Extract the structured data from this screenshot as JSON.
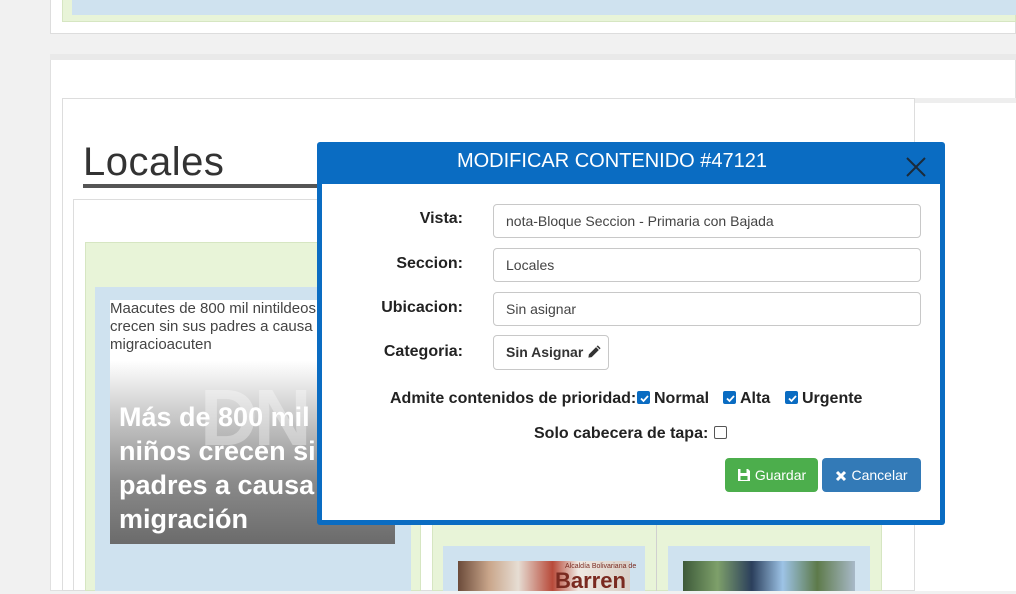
{
  "page": {
    "section_title": "Locales",
    "broken_image_alt": "Maacutes de 800 mil nintildeos crecen sin sus padres a causa de la migracioacuten",
    "watermark": "DN",
    "news_headline": "Más de 800 mil niños crecen sin sus padres a causa de la migración",
    "thumb1_caption_small": "Alcaldía Bolivariana de",
    "thumb1_caption": "Barren"
  },
  "modal": {
    "title": "MODIFICAR CONTENIDO #47121",
    "vista_label": "Vista:",
    "vista_value": "nota-Bloque Seccion - Primaria con Bajada",
    "seccion_label": "Seccion:",
    "seccion_value": "Locales",
    "ubicacion_label": "Ubicacion:",
    "ubicacion_value": "Sin asignar",
    "categoria_label": "Categoria:",
    "categoria_button": "Sin Asignar",
    "prioridad_label": "Admite contenidos de prioridad:",
    "prioridades": [
      {
        "label": "Normal",
        "checked": true
      },
      {
        "label": "Alta",
        "checked": true
      },
      {
        "label": "Urgente",
        "checked": true
      }
    ],
    "solo_cabecera_label": "Solo cabecera de tapa:",
    "solo_cabecera_checked": false,
    "save_label": "Guardar",
    "cancel_label": "Cancelar"
  },
  "colors": {
    "modal_header": "#0a6cc2",
    "save_button": "#4cae4c",
    "cancel_button": "#337ab7"
  },
  "icons": [
    "close-icon",
    "pencil-icon",
    "save-icon",
    "times-icon",
    "check-icon"
  ]
}
